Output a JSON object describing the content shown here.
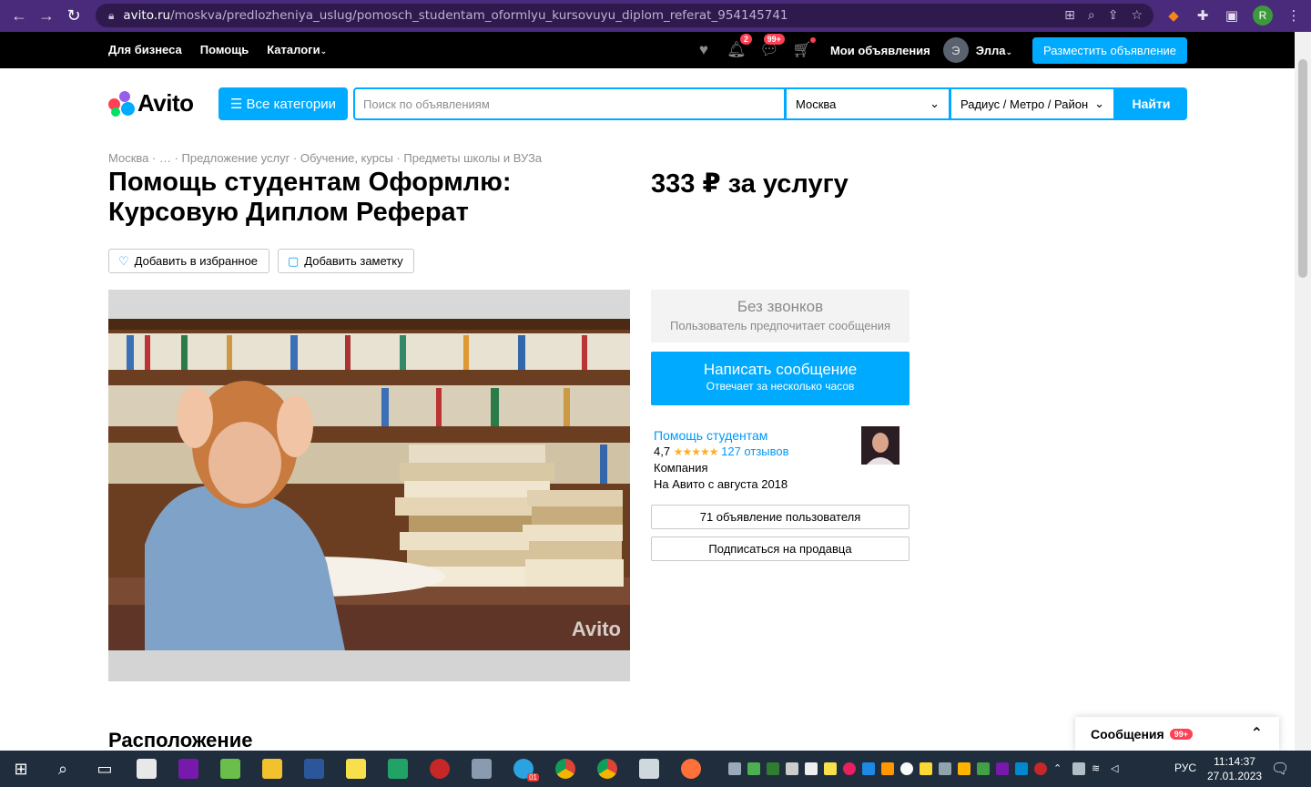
{
  "browser": {
    "url_host": "avito.ru",
    "url_path": "/moskva/predlozheniya_uslug/pomosch_studentam_oformlyu_kursovuyu_diplom_referat_954145741",
    "profile_letter": "R"
  },
  "topbar": {
    "business": "Для бизнеса",
    "help": "Помощь",
    "catalogs": "Каталоги",
    "notif_badge": "2",
    "messages_badge": "99+",
    "my_ads": "Мои объявления",
    "user_initial": "Э",
    "user_name": "Элла",
    "place_ad": "Разместить объявление"
  },
  "search": {
    "logo": "Avito",
    "categories": "Все категории",
    "placeholder": "Поиск по объявлениям",
    "city": "Москва",
    "radius": "Радиус / Метро / Район",
    "button": "Найти"
  },
  "breadcrumbs": [
    "Москва",
    " · … · ",
    "Предложение услуг",
    " · ",
    "Обучение, курсы",
    " · ",
    "Предметы школы и ВУЗа"
  ],
  "listing": {
    "title": "Помощь студентам Оформлю: Курсовую Диплом Реферат",
    "price": "333 ₽ за услугу",
    "add_favorite": "Добавить в избранное",
    "add_note": "Добавить заметку",
    "watermark": "Avito"
  },
  "contact": {
    "no_calls_title": "Без звонков",
    "no_calls_sub": "Пользователь предпочитает сообщения",
    "write_title": "Написать сообщение",
    "write_sub": "Отвечает за несколько часов"
  },
  "seller": {
    "name": "Помощь студентам",
    "rating": "4,7",
    "stars": "★★★★★",
    "reviews": "127 отзывов",
    "type": "Компания",
    "since": "На Авито с августа 2018",
    "ads_button": "71 объявление пользователя",
    "subscribe_button": "Подписаться на продавца"
  },
  "section": {
    "location": "Расположение"
  },
  "messages_widget": {
    "label": "Сообщения",
    "badge": "99+"
  },
  "taskbar": {
    "lang": "РУС",
    "time": "11:14:37",
    "date": "27.01.2023",
    "telegram_badge": "01"
  }
}
